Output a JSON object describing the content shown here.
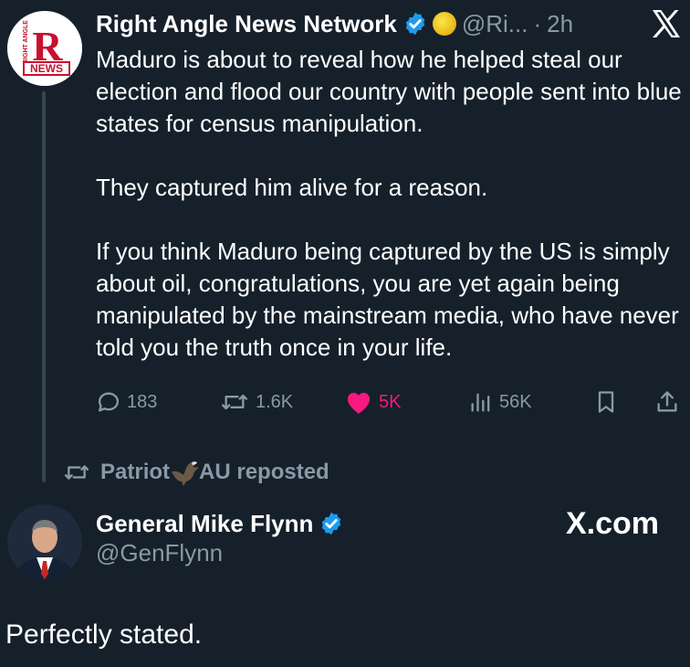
{
  "tweet": {
    "author_name": "Right Angle News Network",
    "handle": "@Ri...",
    "separator": "·",
    "time": "2h",
    "paragraphs": [
      "Maduro is about to reveal how he helped steal our election and flood our country with people sent into blue states for census manipulation.",
      "They captured him alive for a reason.",
      "If you think Maduro being captured by the US is simply about oil, congratulations, you are yet again being manipulated by the mainstream media, who have never told you the truth once in your life."
    ],
    "actions": {
      "replies": "183",
      "reposts": "1.6K",
      "likes": "5K",
      "views": "56K"
    },
    "avatar_logo": {
      "letter": "R",
      "side_text": "RIGHT ANGLE",
      "banner": "NEWS"
    }
  },
  "repost": {
    "name_start": "Patriot",
    "name_end": "AU reposted"
  },
  "post": {
    "author_name": "General Mike Flynn",
    "handle": "@GenFlynn",
    "watermark": "X.com"
  },
  "caption": "Perfectly stated.",
  "colors": {
    "background": "#15202b",
    "muted": "#8b98a5",
    "like": "#f91880",
    "verified": "#1d9bf0"
  },
  "icons": [
    "verified-badge-icon",
    "gold-circle-icon",
    "x-logo-icon",
    "reply-icon",
    "repost-icon",
    "like-icon",
    "views-icon",
    "bookmark-icon",
    "share-icon",
    "eagle-icon"
  ]
}
